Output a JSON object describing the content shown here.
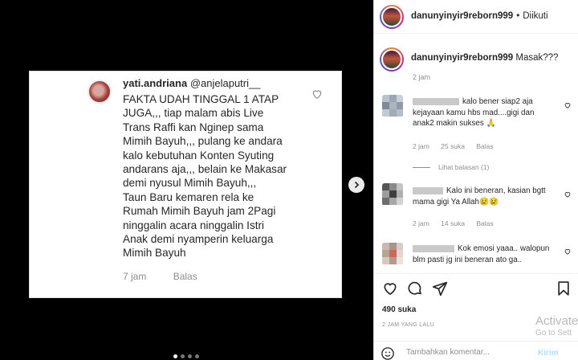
{
  "post_image": {
    "username": "yati.andriana",
    "mention": "@anjelaputri__",
    "lines": [
      "FAKTA UDAH TINGGAL 1 ATAP",
      "JUGA,,, tiap malam abis Live",
      "Trans Raffi kan Nginep sama",
      "Mimih Bayuh,,, pulang ke andara",
      "kalo kebutuhan Konten Syuting",
      "andarans aja,,, belain ke Makasar",
      "demi nyusul Mimih Bayuh,,,",
      "Taun Baru kemaren rela ke",
      "Rumah Mimih Bayuh jam 2Pagi",
      "ninggalin acara ninggalin Istri",
      "Anak demi nyamperin keluarga",
      "Mimih Bayuh"
    ],
    "time": "7 jam",
    "reply": "Balas",
    "carousel_dots": 4,
    "carousel_active": 1
  },
  "header": {
    "username": "danunyinyir9reborn999",
    "separator": "•",
    "follow_label": "Diikuti"
  },
  "caption": {
    "username": "danunyinyir9reborn999",
    "text": "Masak???",
    "time": "2 jam"
  },
  "comments": [
    {
      "text": "kalo bener siap2 aja kejayaan kamu hbs mad....gigi dan anak2 makin sukses 🙏",
      "lines": [
        "kalo bener siap2 aja",
        "kejayaan kamu hbs mad....gigi dan",
        "anak2 makin sukses 🙏"
      ],
      "time": "2 jam",
      "likes": "25 suka",
      "reply": "Balas"
    },
    {
      "lines": [
        "Kalo ini beneran, kasian bgtt",
        "mama gigi Ya Allah😢😢"
      ],
      "time": "2 jam",
      "likes": "14 suka",
      "reply": "Balas"
    },
    {
      "lines": [
        "Kok emosi yaaa.. walopun",
        "blm pasti jg ini beneran ato ga.."
      ]
    }
  ],
  "view_replies": "Lihat balasan (1)",
  "likes": "490 suka",
  "posted": "2 JAM YANG LALU",
  "add_comment": {
    "placeholder": "Tambahkan komentar...",
    "send": "Kirim"
  },
  "watermark": {
    "line1": "Activate",
    "line2": "Go to Sett"
  },
  "colors": {
    "link_blue": "#0095f6",
    "send_disabled": "#b2dffc",
    "muted": "#8e8e8e"
  }
}
